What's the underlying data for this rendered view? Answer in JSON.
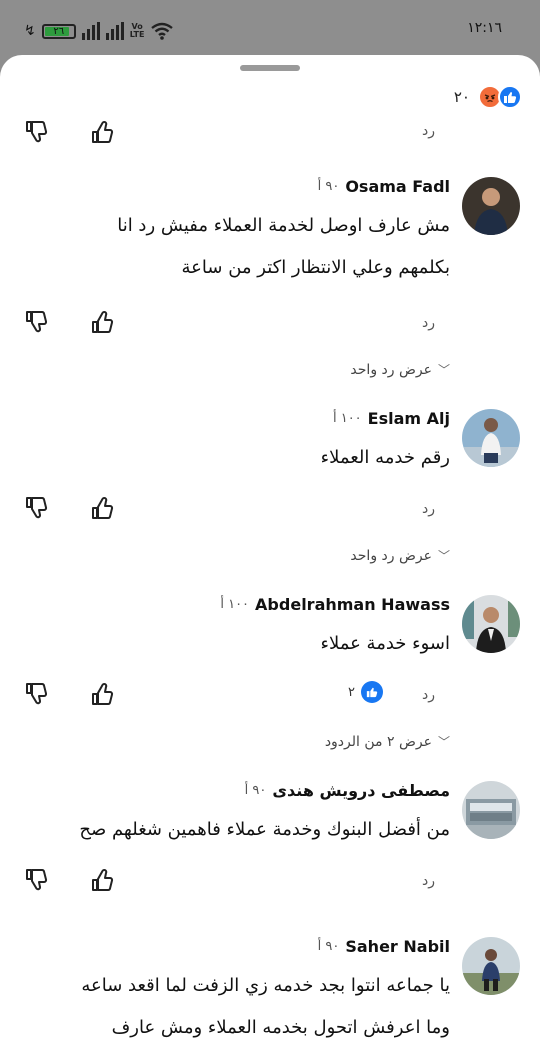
{
  "status_bar": {
    "time": "١٢:١٦",
    "battery": "٢٦",
    "network": "Vo LTE"
  },
  "reactions": {
    "count": "٢٠"
  },
  "top_reply_label": "رد",
  "comments": [
    {
      "name": "Osama Fadl",
      "time": "٩٠ أ",
      "lines": [
        "مش عارف اوصل لخدمة العملاء مفيش رد انا",
        "بكلمهم وعلي الانتظار اكتر من ساعة"
      ],
      "reply": "رد",
      "more": "عرض رد واحد"
    },
    {
      "name": "Eslam Alj",
      "time": "١٠٠ أ",
      "lines": [
        "رقم خدمه العملاء"
      ],
      "reply": "رد",
      "more": "عرض رد واحد"
    },
    {
      "name": "Abdelrahman Hawass",
      "time": "١٠٠ أ",
      "lines": [
        "اسوء خدمة عملاء"
      ],
      "reply": "رد",
      "likes": "٢",
      "more": "عرض ٢ من الردود"
    },
    {
      "name": "مصطفى درويش هندى",
      "time": "٩٠ أ",
      "lines": [
        "من أفضل البنوك وخدمة عملاء فاهمين شغلهم صح"
      ],
      "reply": "رد"
    },
    {
      "name": "Saher Nabil",
      "time": "٩٠ أ",
      "lines": [
        "يا جماعه انتوا بجد خدمه زي الزفت لما اقعد ساعه",
        "وما اعرفش اتحول بخدمه العملاء ومش عارف"
      ]
    }
  ]
}
